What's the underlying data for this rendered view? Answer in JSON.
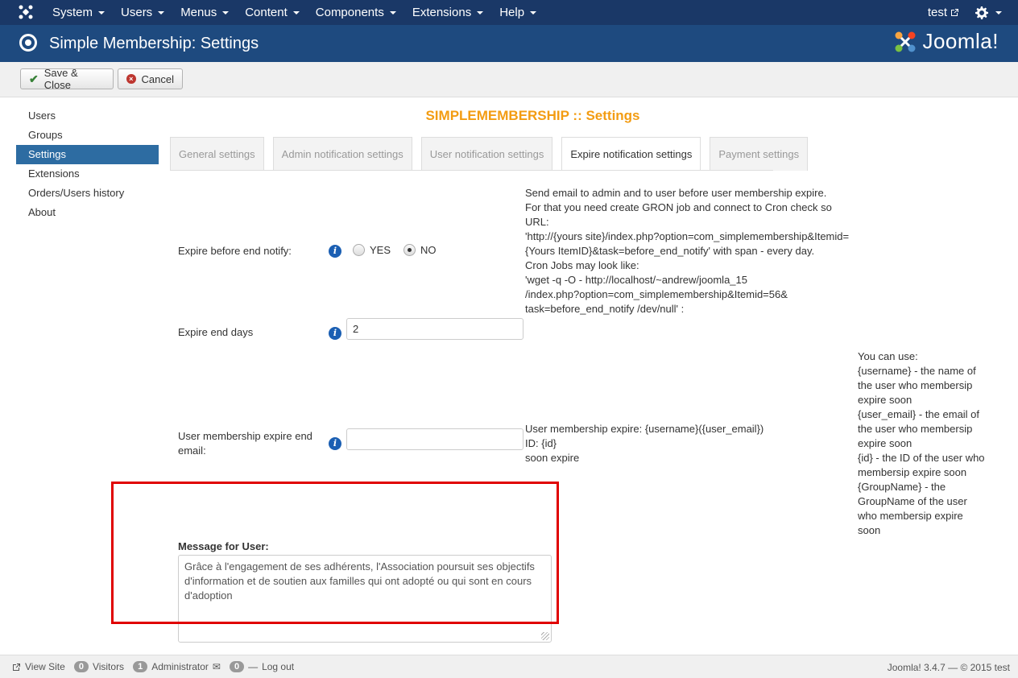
{
  "navbar": {
    "menu": [
      "System",
      "Users",
      "Menus",
      "Content",
      "Components",
      "Extensions",
      "Help"
    ],
    "user": "test"
  },
  "header": {
    "title": "Simple Membership: Settings",
    "brand": "Joomla!"
  },
  "toolbar": {
    "save_close": "Save & Close",
    "cancel": "Cancel"
  },
  "sidebar": {
    "items": [
      {
        "label": "Users"
      },
      {
        "label": "Groups"
      },
      {
        "label": "Settings",
        "active": true
      },
      {
        "label": "Extensions"
      },
      {
        "label": "Orders/Users history"
      },
      {
        "label": "About"
      }
    ]
  },
  "main": {
    "heading": "SIMPLEMEMBERSHIP :: Settings",
    "tabs": [
      {
        "label": "General settings"
      },
      {
        "label": "Admin notification settings"
      },
      {
        "label": "User notification settings"
      },
      {
        "label": "Expire notification settings",
        "active": true
      },
      {
        "label": "Payment settings"
      }
    ],
    "expire_notify": {
      "label": "Expire before end notify:",
      "yes": "YES",
      "no": "NO",
      "selected": "NO",
      "desc": [
        "Send email to admin and to user before user membership expire.",
        "For that you need create GRON job and connect to Cron check so",
        "URL:",
        "'http://{yours site}/index.php?option=com_simplemembership&Itemid=",
        "{Yours ItemID}&task=before_end_notify' with span - every day.",
        "Cron Jobs may look like:",
        "'wget -q -O - http://localhost/~andrew/joomla_15",
        "/index.php?option=com_simplemembership&Itemid=56&",
        "task=before_end_notify /dev/null' :"
      ]
    },
    "expire_days": {
      "label": "Expire end days",
      "value": "2"
    },
    "expire_email": {
      "label_line1": "User membership expire end",
      "label_line2": "email:",
      "value": "",
      "desc": [
        "User membership expire: {username}({user_email})",
        "ID: {id}",
        "soon expire"
      ]
    },
    "help": [
      "You can use:",
      "{username} - the name of",
      "the user who membersip",
      "expire soon",
      "{user_email} - the email of",
      "the user who membersip",
      "expire soon",
      "{id} - the ID of the user who",
      "membersip expire soon",
      "{GroupName} - the",
      "GroupName of the user",
      "who membersip expire",
      "soon"
    ],
    "message": {
      "label": "Message for User:",
      "value": "Grâce à l'engagement de ses adhérents, l'Association poursuit ses objectifs d'information et de soutien aux familles qui ont adopté ou qui sont en cours d'adoption"
    }
  },
  "statusbar": {
    "view_site": "View Site",
    "visitors_count": "0",
    "visitors": "Visitors",
    "admin_count": "1",
    "admin": "Administrator",
    "messages_count": "0",
    "logout": "Log out",
    "version": "Joomla! 3.4.7 — © 2015 test"
  },
  "colors": {
    "navbar": "#1a3867",
    "header": "#1e4a7f",
    "heading": "#f39c12",
    "active_side": "#2d6ca2",
    "highlight": "#e00000"
  }
}
